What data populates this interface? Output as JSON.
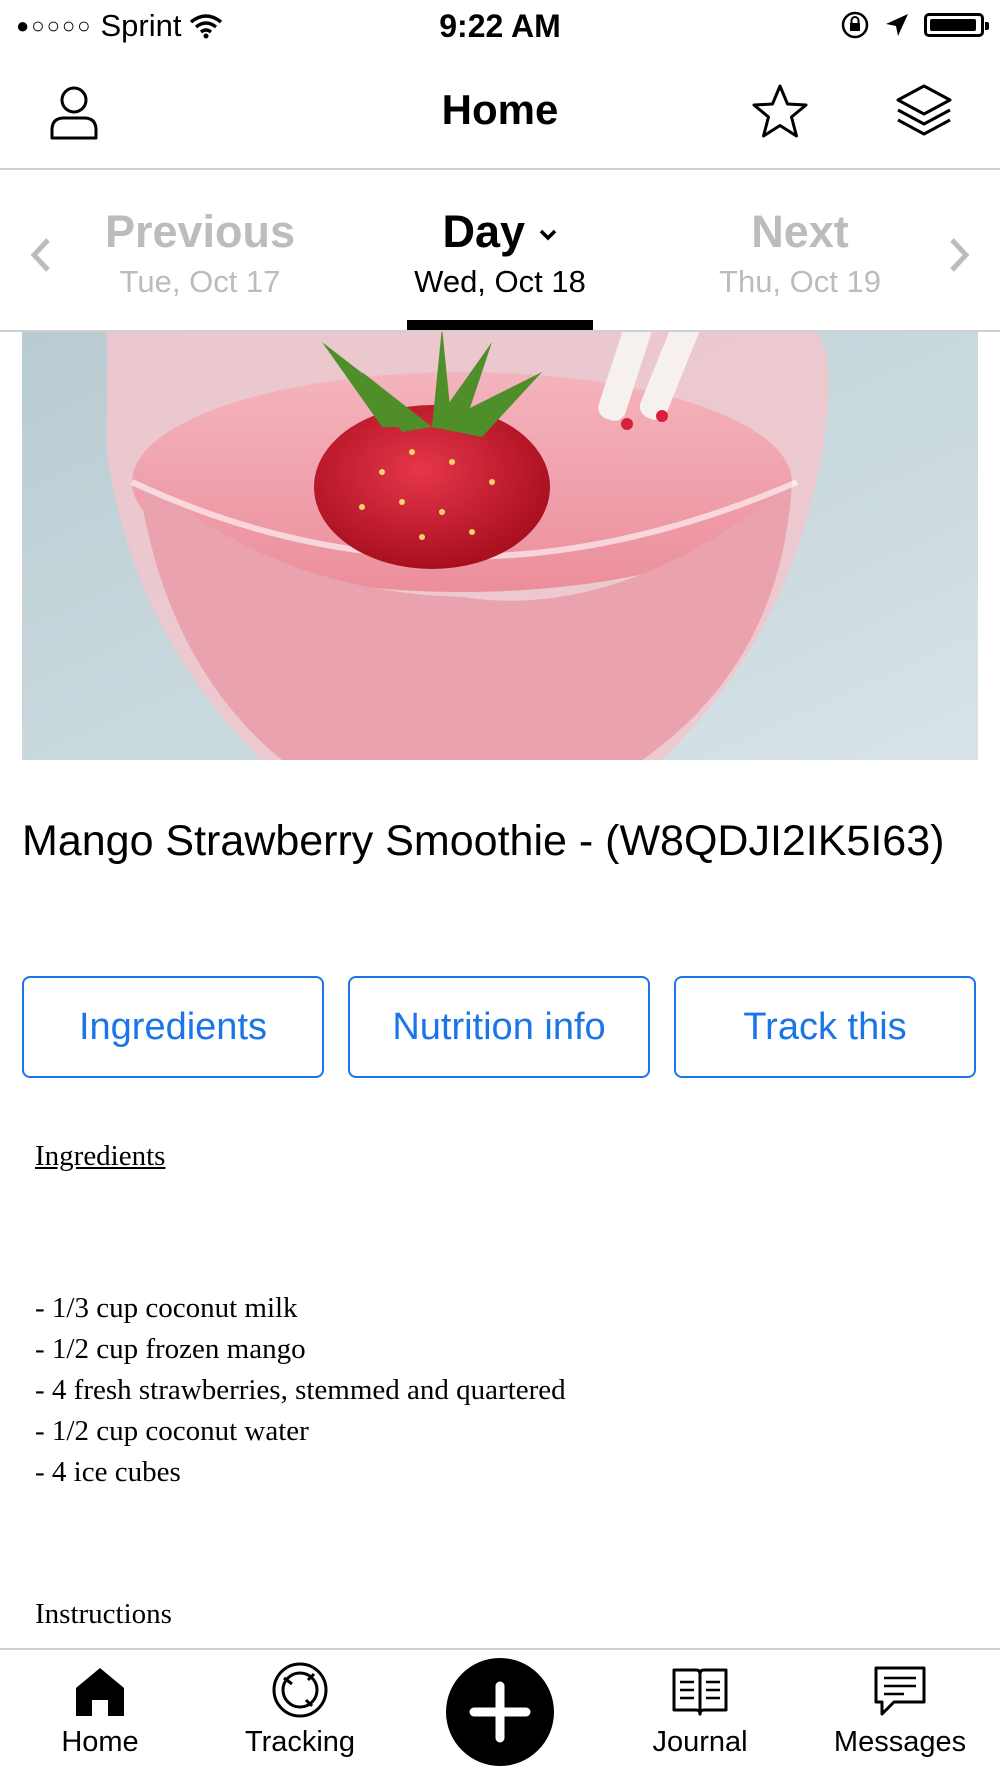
{
  "status_bar": {
    "signal_dots": "●○○○○",
    "carrier": "Sprint",
    "time": "9:22 AM"
  },
  "nav": {
    "title": "Home"
  },
  "day_nav": {
    "previous_label": "Previous",
    "previous_date": "Tue, Oct 17",
    "current_label": "Day",
    "current_date": "Wed, Oct 18",
    "next_label": "Next",
    "next_date": "Thu, Oct 19"
  },
  "recipe": {
    "title": "Mango Strawberry Smoothie - (W8QDJI2IK5I63)"
  },
  "buttons": {
    "ingredients": "Ingredients",
    "nutrition": "Nutrition info",
    "track": "Track this"
  },
  "content": {
    "heading": "Ingredients",
    "items": [
      "- 1/3 cup coconut milk",
      "- 1/2 cup frozen mango",
      "- 4 fresh strawberries, stemmed and quartered",
      "- 1/2 cup coconut water",
      "- 4 ice cubes"
    ],
    "instructions_heading": "Instructions"
  },
  "tabs": {
    "home": "Home",
    "tracking": "Tracking",
    "journal": "Journal",
    "messages": "Messages"
  },
  "colors": {
    "accent": "#1a75e8",
    "muted": "#bcbcbc",
    "divider": "#d0d0d0"
  }
}
